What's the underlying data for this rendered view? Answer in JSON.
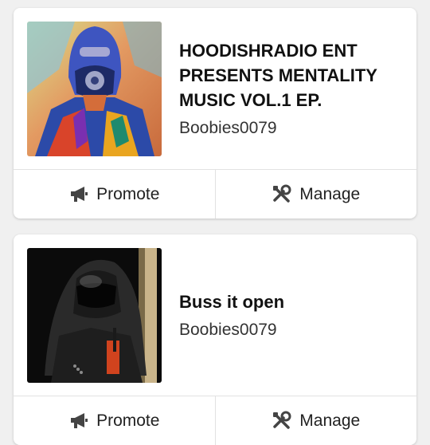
{
  "releases": [
    {
      "title": "HOODISHRADIO ENT PRESENTS MENTALITY MUSIC VOL.1 EP.",
      "artist": "Boobies0079",
      "cover_icon": "album-cover-art",
      "promote_label": "Promote",
      "manage_label": "Manage"
    },
    {
      "title": "Buss it open",
      "artist": "Boobies0079",
      "cover_icon": "album-cover-photo",
      "promote_label": "Promote",
      "manage_label": "Manage"
    }
  ],
  "icons": {
    "promote": "megaphone-icon",
    "manage": "tools-icon"
  },
  "colors": {
    "background": "#f0f0f0",
    "card": "#ffffff",
    "text": "#111111",
    "icon": "#444444"
  }
}
